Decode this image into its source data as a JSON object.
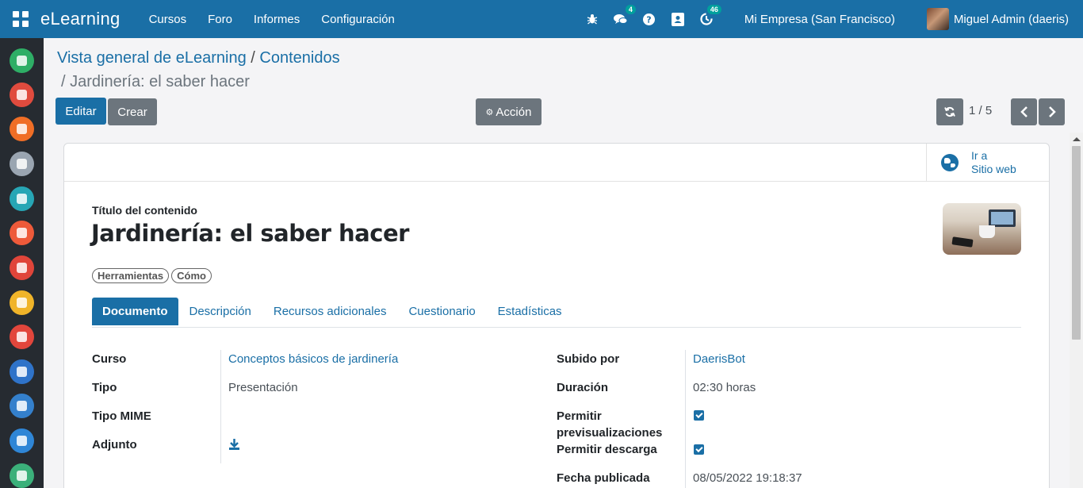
{
  "navbar": {
    "brand": "eLearning",
    "menu": [
      "Cursos",
      "Foro",
      "Informes",
      "Configuración"
    ],
    "chat_badge": "4",
    "activity_badge": "46",
    "company": "Mi Empresa (San Francisco)",
    "user": "Miguel Admin (daeris)"
  },
  "sidebar_apps": [
    {
      "name": "app-1",
      "color": "#2eae66"
    },
    {
      "name": "app-2",
      "color": "#e04b3e"
    },
    {
      "name": "app-3",
      "color": "#f06e26"
    },
    {
      "name": "app-4",
      "color": "#9aa5b1"
    },
    {
      "name": "app-5",
      "color": "#27a6b5"
    },
    {
      "name": "app-6",
      "color": "#ee5a3a"
    },
    {
      "name": "app-7",
      "color": "#e0453a"
    },
    {
      "name": "app-8",
      "color": "#f0b429"
    },
    {
      "name": "app-9",
      "color": "#e2463c"
    },
    {
      "name": "app-10",
      "color": "#2f73c9"
    },
    {
      "name": "app-11",
      "color": "#3480cc"
    },
    {
      "name": "app-12",
      "color": "#2f86d6"
    },
    {
      "name": "app-13",
      "color": "#3bb07a"
    }
  ],
  "breadcrumb": {
    "parent": "Vista general de eLearning",
    "section": "Contenidos",
    "current": "Jardinería: el saber hacer"
  },
  "buttons": {
    "edit": "Editar",
    "create": "Crear",
    "action": "Acción"
  },
  "pager": {
    "value": "1 / 5"
  },
  "stat_button": {
    "line1": "Ir a",
    "line2": "Sitio web"
  },
  "form": {
    "title_label": "Título del contenido",
    "title": "Jardinería: el saber hacer",
    "tags": [
      "Herramientas",
      "Cómo"
    ],
    "tabs": [
      "Documento",
      "Descripción",
      "Recursos adicionales",
      "Cuestionario",
      "Estadísticas"
    ],
    "left": {
      "course_label": "Curso",
      "course": "Conceptos básicos de jardinería",
      "type_label": "Tipo",
      "type": "Presentación",
      "mime_label": "Tipo MIME",
      "attachment_label": "Adjunto"
    },
    "right": {
      "uploaded_label": "Subido por",
      "uploaded": "DaerisBot",
      "duration_label": "Duración",
      "duration": "02:30 horas",
      "preview_label_1": "Permitir",
      "preview_label_2": "previsualizaciones",
      "download_label": "Permitir descarga",
      "published_label": "Fecha publicada",
      "published": "08/05/2022 19:18:37"
    }
  }
}
